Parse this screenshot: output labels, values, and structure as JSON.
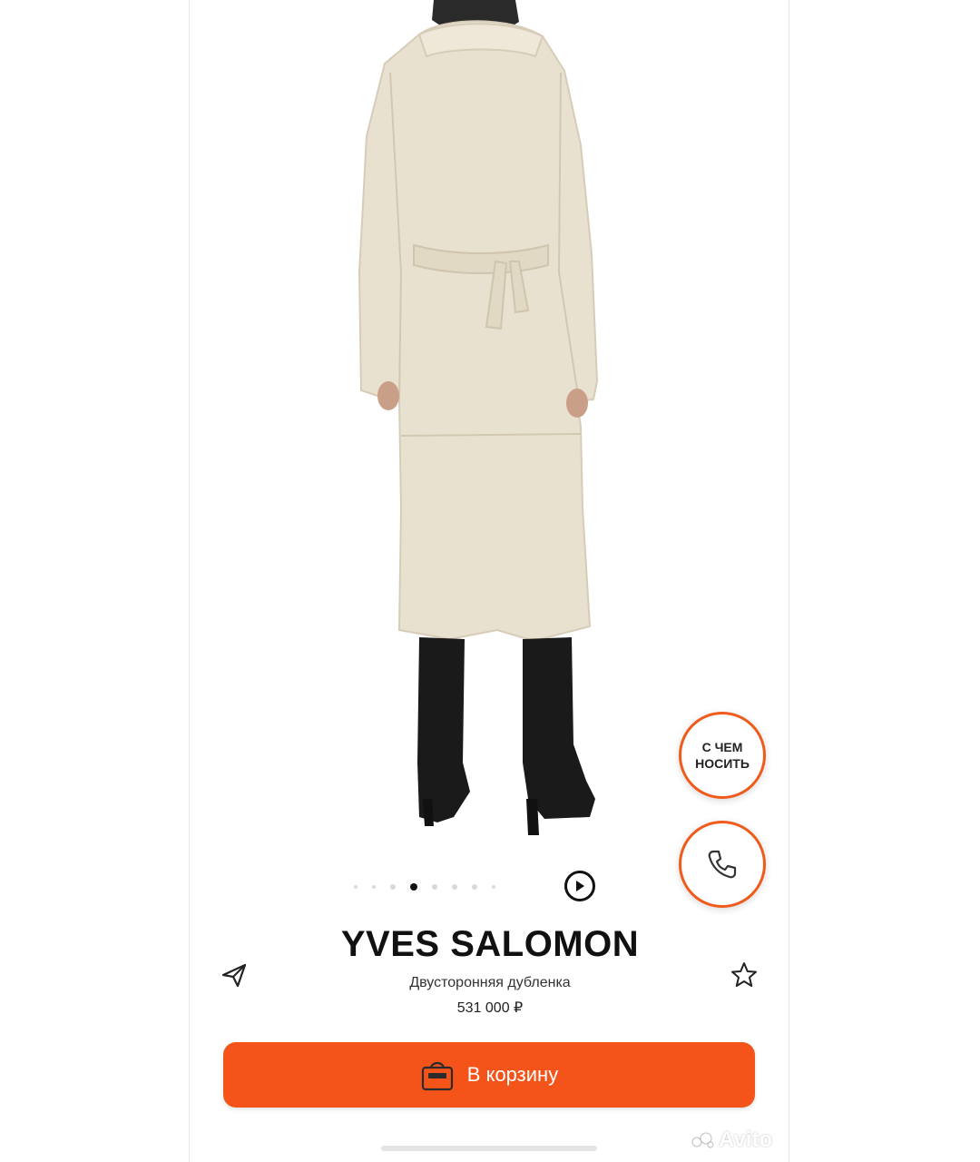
{
  "product": {
    "brand": "YVES SALOMON",
    "title": "Двусторонняя дубленка",
    "price": "531 000 ₽"
  },
  "carousel": {
    "dot_count": 8,
    "active_index": 3,
    "play_icon": "play-icon"
  },
  "actions": {
    "what_to_wear": "С ЧЕМ НОСИТЬ",
    "call_icon": "phone-icon",
    "share_icon": "send-icon",
    "favorite_icon": "star-icon",
    "cart_label": "В корзину",
    "cart_icon": "bag-icon"
  },
  "watermark": {
    "text": "Avito"
  },
  "colors": {
    "accent": "#f4541a",
    "coat": "#e9e1d0",
    "boots": "#1a1a1a"
  }
}
